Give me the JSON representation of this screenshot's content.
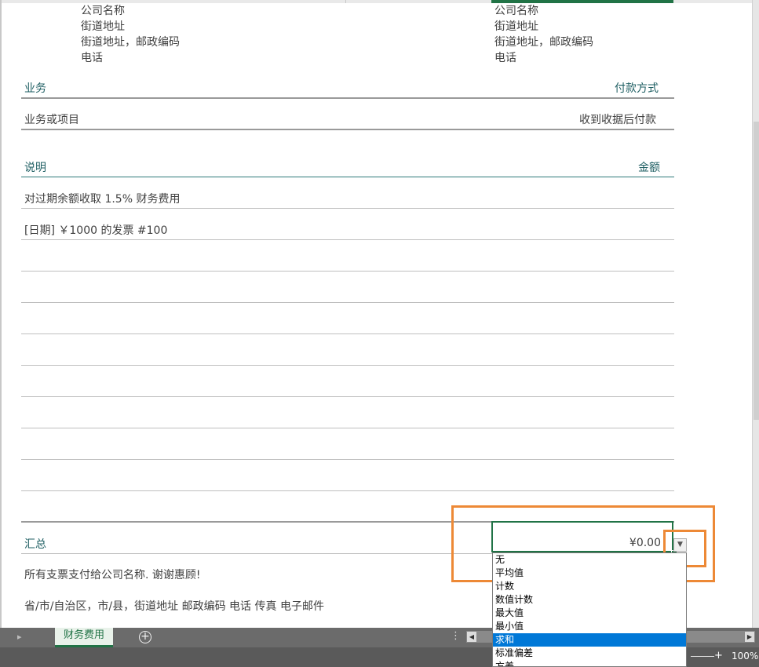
{
  "invoice": {
    "left_block": [
      "公司名称",
      "街道地址",
      "街道地址，邮政编码",
      "电话"
    ],
    "right_block": [
      "公司名称",
      "街道地址",
      "街道地址，邮政编码",
      "电话"
    ],
    "business_label": "业务",
    "payment_label": "付款方式",
    "business_value": "业务或项目",
    "payment_value": "收到收据后付款",
    "desc_label": "说明",
    "amount_label": "金额",
    "lines": [
      "对过期余额收取 1.5% 财务费用",
      "[日期] ￥1000 的发票 #100"
    ],
    "total_label": "汇总",
    "total_value": "¥0.00",
    "footer_note": "所有支票支付给公司名称. 谢谢惠顾!",
    "footer_address": "省/市/自治区，市/县，街道地址  邮政编码  电话   传真   电子邮件"
  },
  "dropdown": {
    "items": [
      "无",
      "平均值",
      "计数",
      "数值计数",
      "最大值",
      "最小值",
      "求和",
      "标准偏差",
      "方差"
    ],
    "selected_index": 6,
    "selected": "求和"
  },
  "sheet": {
    "tab_label": "财务费用",
    "add_symbol": "+",
    "more_symbol": "⋮",
    "zoom": "100%"
  },
  "colors": {
    "accent": "#217346",
    "highlight": "#ed8936",
    "selection": "#0078d7",
    "heading": "#1f5f63"
  }
}
